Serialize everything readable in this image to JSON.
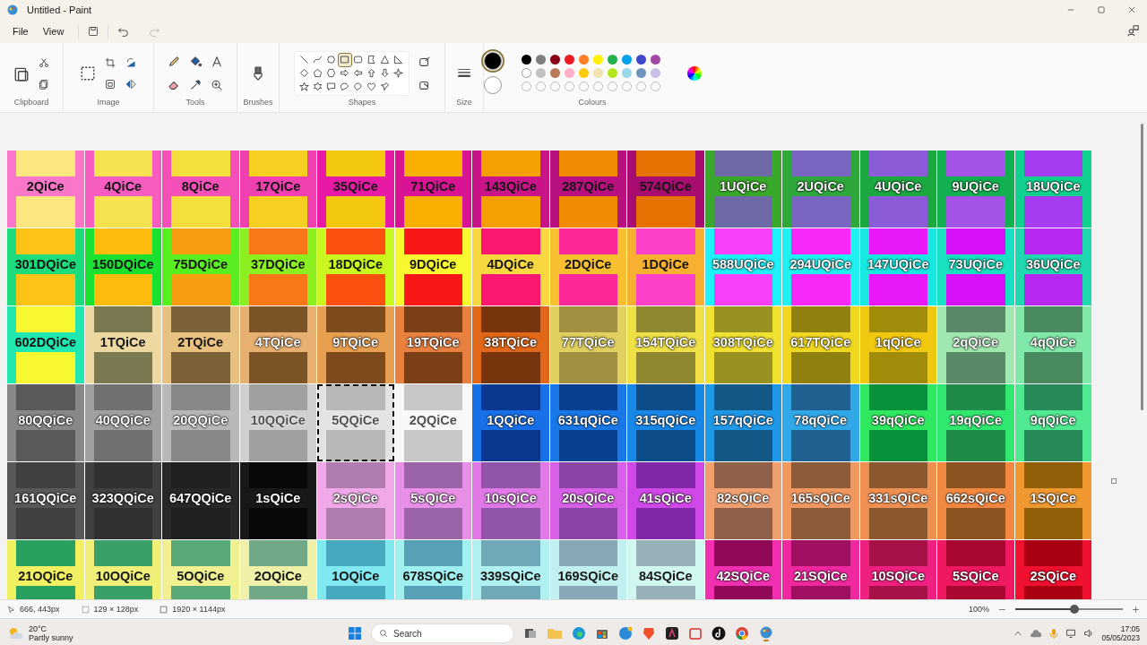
{
  "window": {
    "title": "Untitled - Paint"
  },
  "menu": [
    "File",
    "View"
  ],
  "ribbon_groups": [
    "Clipboard",
    "Image",
    "Tools",
    "Brushes",
    "Shapes",
    "Size",
    "Colours"
  ],
  "shapes": [
    {
      "kind": "line",
      "selected": false
    },
    {
      "kind": "curve",
      "selected": false
    },
    {
      "kind": "oval",
      "selected": false
    },
    {
      "kind": "rectangle",
      "selected": true
    },
    {
      "kind": "rounded",
      "selected": false
    },
    {
      "kind": "polygon",
      "selected": false
    },
    {
      "kind": "triangle",
      "selected": false
    },
    {
      "kind": "right-triangle",
      "selected": false
    },
    {
      "kind": "diamond",
      "selected": false
    },
    {
      "kind": "pentagon",
      "selected": false
    },
    {
      "kind": "hexagon",
      "selected": false
    },
    {
      "kind": "arrow-right",
      "selected": false
    },
    {
      "kind": "arrow-left",
      "selected": false
    },
    {
      "kind": "arrow-up",
      "selected": false
    },
    {
      "kind": "arrow-down",
      "selected": false
    },
    {
      "kind": "star-four",
      "selected": false
    },
    {
      "kind": "star-five",
      "selected": false
    },
    {
      "kind": "star-six",
      "selected": false
    },
    {
      "kind": "callout-rect",
      "selected": false
    },
    {
      "kind": "callout-oval",
      "selected": false
    },
    {
      "kind": "callout-round",
      "selected": false
    },
    {
      "kind": "heart",
      "selected": false
    },
    {
      "kind": "pin",
      "selected": false
    }
  ],
  "primary_colour": {
    "color": "#000000",
    "selected": true
  },
  "secondary_colour": {
    "color": "#ffffff",
    "selected": false
  },
  "palette": [
    {
      "kind": "swatch",
      "color": "#000000"
    },
    {
      "kind": "swatch",
      "color": "#7f7f7f"
    },
    {
      "kind": "swatch",
      "color": "#880015"
    },
    {
      "kind": "swatch",
      "color": "#ed1c24"
    },
    {
      "kind": "swatch",
      "color": "#ff7f27"
    },
    {
      "kind": "swatch",
      "color": "#fff200"
    },
    {
      "kind": "swatch",
      "color": "#22b14c"
    },
    {
      "kind": "swatch",
      "color": "#00a2e8"
    },
    {
      "kind": "swatch",
      "color": "#3f48cc"
    },
    {
      "kind": "swatch",
      "color": "#a349a4"
    },
    {
      "kind": "swatch",
      "color": "#ffffff"
    },
    {
      "kind": "swatch",
      "color": "#c3c3c3"
    },
    {
      "kind": "swatch",
      "color": "#b97a57"
    },
    {
      "kind": "swatch",
      "color": "#ffaec9"
    },
    {
      "kind": "swatch",
      "color": "#ffc90e"
    },
    {
      "kind": "swatch",
      "color": "#efe4b0"
    },
    {
      "kind": "swatch",
      "color": "#b5e61d"
    },
    {
      "kind": "swatch",
      "color": "#99d9ea"
    },
    {
      "kind": "swatch",
      "color": "#7092be"
    },
    {
      "kind": "swatch",
      "color": "#c8bfe7"
    },
    {
      "kind": "empty"
    },
    {
      "kind": "empty"
    },
    {
      "kind": "empty"
    },
    {
      "kind": "empty"
    },
    {
      "kind": "empty"
    },
    {
      "kind": "empty"
    },
    {
      "kind": "empty"
    },
    {
      "kind": "empty"
    },
    {
      "kind": "empty"
    },
    {
      "kind": "empty"
    }
  ],
  "canvas": {
    "rows": [
      {
        "tiles": [
          {
            "label": "2QiCe",
            "frame": {
              "color": "#f976c8"
            },
            "swatch": {
              "color": "#fbe67f"
            },
            "kind": "dark",
            "selected": false
          },
          {
            "label": "4QiCe",
            "frame": {
              "color": "#f75cc0"
            },
            "swatch": {
              "color": "#f7e34f"
            },
            "kind": "dark",
            "selected": false
          },
          {
            "label": "8QiCe",
            "frame": {
              "color": "#f550b8"
            },
            "swatch": {
              "color": "#f5df3f"
            },
            "kind": "dark",
            "selected": false
          },
          {
            "label": "17QiCe",
            "frame": {
              "color": "#f040b0"
            },
            "swatch": {
              "color": "#f5d020"
            },
            "kind": "dark",
            "selected": false
          },
          {
            "label": "35QiCe",
            "frame": {
              "color": "#e61aa5"
            },
            "swatch": {
              "color": "#f5c810"
            },
            "kind": "dark",
            "selected": false
          },
          {
            "label": "71QiCe",
            "frame": {
              "color": "#d81495"
            },
            "swatch": {
              "color": "#f8b000"
            },
            "kind": "dark",
            "selected": false
          },
          {
            "label": "143QiCe",
            "frame": {
              "color": "#c81488"
            },
            "swatch": {
              "color": "#f5a000"
            },
            "kind": "dark",
            "selected": false
          },
          {
            "label": "287QiCe",
            "frame": {
              "color": "#b8107e"
            },
            "swatch": {
              "color": "#f08a00"
            },
            "kind": "dark",
            "selected": false
          },
          {
            "label": "574QiCe",
            "frame": {
              "color": "#a80c70"
            },
            "swatch": {
              "color": "#e67000"
            },
            "kind": "dark",
            "selected": false
          },
          {
            "label": "1UQiCe",
            "frame": {
              "color": "#3aa82a"
            },
            "swatch": {
              "color": "#6e6aa8"
            },
            "kind": "light",
            "selected": false
          },
          {
            "label": "2UQiCe",
            "frame": {
              "color": "#2ea83a"
            },
            "swatch": {
              "color": "#7a66c0"
            },
            "kind": "light",
            "selected": false
          },
          {
            "label": "4UQiCe",
            "frame": {
              "color": "#1ca840"
            },
            "swatch": {
              "color": "#8c5cd8"
            },
            "kind": "light",
            "selected": false
          },
          {
            "label": "9UQiCe",
            "frame": {
              "color": "#12b050"
            },
            "swatch": {
              "color": "#a455e8"
            },
            "kind": "light",
            "selected": false
          },
          {
            "label": "18UQiCe",
            "frame": {
              "color": "#10d090"
            },
            "swatch": {
              "color": "#a83cf0"
            },
            "kind": "light",
            "selected": false
          }
        ]
      },
      {
        "tiles": [
          {
            "label": "301DQiCe",
            "frame": {
              "color": "#1cdc7c"
            },
            "swatch": {
              "color": "#fcc417"
            },
            "kind": "dark",
            "selected": false
          },
          {
            "label": "150DQiCe",
            "frame": {
              "color": "#1ae030"
            },
            "swatch": {
              "color": "#fcbc10"
            },
            "kind": "dark",
            "selected": false
          },
          {
            "label": "75DQiCe",
            "frame": {
              "color": "#58ee20"
            },
            "swatch": {
              "color": "#f89c10"
            },
            "kind": "dark",
            "selected": false
          },
          {
            "label": "37DQiCe",
            "frame": {
              "color": "#8cf020"
            },
            "swatch": {
              "color": "#f87818"
            },
            "kind": "dark",
            "selected": false
          },
          {
            "label": "18DQiCe",
            "frame": {
              "color": "#c8f820"
            },
            "swatch": {
              "color": "#fc5010"
            },
            "kind": "dark",
            "selected": false
          },
          {
            "label": "9DQiCe",
            "frame": {
              "color": "#f8f830"
            },
            "swatch": {
              "color": "#f81818"
            },
            "kind": "dark",
            "selected": false
          },
          {
            "label": "4DQiCe",
            "frame": {
              "color": "#f8d840"
            },
            "swatch": {
              "color": "#fc1870"
            },
            "kind": "dark",
            "selected": false
          },
          {
            "label": "2DQiCe",
            "frame": {
              "color": "#f8c030"
            },
            "swatch": {
              "color": "#fc2898"
            },
            "kind": "dark",
            "selected": false
          },
          {
            "label": "1DQiCe",
            "frame": {
              "color": "#f8b030"
            },
            "swatch": {
              "color": "#fc40c8"
            },
            "kind": "dark",
            "selected": false
          },
          {
            "label": "588UQiCe",
            "frame": {
              "color": "#20f0f8"
            },
            "swatch": {
              "color": "#f840f8"
            },
            "kind": "light",
            "selected": false
          },
          {
            "label": "294UQiCe",
            "frame": {
              "color": "#20f0f0"
            },
            "swatch": {
              "color": "#f828f8"
            },
            "kind": "light",
            "selected": false
          },
          {
            "label": "147UQiCe",
            "frame": {
              "color": "#18e8e0"
            },
            "swatch": {
              "color": "#e818f8"
            },
            "kind": "light",
            "selected": false
          },
          {
            "label": "73UQiCe",
            "frame": {
              "color": "#18e0c0"
            },
            "swatch": {
              "color": "#d810f8"
            },
            "kind": "light",
            "selected": false
          },
          {
            "label": "36UQiCe",
            "frame": {
              "color": "#20d8b0"
            },
            "swatch": {
              "color": "#b828f0"
            },
            "kind": "light",
            "selected": false
          }
        ]
      },
      {
        "tiles": [
          {
            "label": "602DQiCe",
            "frame": {
              "color": "#20e8b0"
            },
            "swatch": {
              "color": "#f8f830"
            },
            "kind": "dark",
            "selected": false
          },
          {
            "label": "1TQiCe",
            "frame": {
              "color": "#ecd8a0"
            },
            "swatch": {
              "color": "#7a7850"
            },
            "kind": "dark",
            "selected": false
          },
          {
            "label": "2TQiCe",
            "frame": {
              "color": "#e8c080"
            },
            "swatch": {
              "color": "#7c6038"
            },
            "kind": "dark",
            "selected": false
          },
          {
            "label": "4TQiCe",
            "frame": {
              "color": "#e8b070"
            },
            "swatch": {
              "color": "#7c5428"
            },
            "kind": "light",
            "selected": false
          },
          {
            "label": "9TQiCe",
            "frame": {
              "color": "#e8a050"
            },
            "swatch": {
              "color": "#7c4a1c"
            },
            "kind": "light",
            "selected": false
          },
          {
            "label": "19TQiCe",
            "frame": {
              "color": "#e88040"
            },
            "swatch": {
              "color": "#7c4018"
            },
            "kind": "light",
            "selected": false
          },
          {
            "label": "38TQiCe",
            "frame": {
              "color": "#e06818"
            },
            "swatch": {
              "color": "#78340c"
            },
            "kind": "light",
            "selected": false
          },
          {
            "label": "77TQiCe",
            "frame": {
              "color": "#e0d060"
            },
            "swatch": {
              "color": "#a09040"
            },
            "kind": "light",
            "selected": false
          },
          {
            "label": "154TQiCe",
            "frame": {
              "color": "#f0e048"
            },
            "swatch": {
              "color": "#908830"
            },
            "kind": "light",
            "selected": false
          },
          {
            "label": "308TQiCe",
            "frame": {
              "color": "#f0e030"
            },
            "swatch": {
              "color": "#989020"
            },
            "kind": "light",
            "selected": false
          },
          {
            "label": "617TQiCe",
            "frame": {
              "color": "#f0d820"
            },
            "swatch": {
              "color": "#908010"
            },
            "kind": "light",
            "selected": false
          },
          {
            "label": "1qQiCe",
            "frame": {
              "color": "#f0c810"
            },
            "swatch": {
              "color": "#a08c08"
            },
            "kind": "light",
            "selected": false
          },
          {
            "label": "2qQiCe",
            "frame": {
              "color": "#a0e8b0"
            },
            "swatch": {
              "color": "#588a68"
            },
            "kind": "light",
            "selected": false
          },
          {
            "label": "4qQiCe",
            "frame": {
              "color": "#80e8a8"
            },
            "swatch": {
              "color": "#4a8a60"
            },
            "kind": "light",
            "selected": false
          }
        ]
      },
      {
        "tiles": [
          {
            "label": "80QQiCe",
            "frame": {
              "color": "#888888"
            },
            "swatch": {
              "color": "#5a5a5a"
            },
            "kind": "light",
            "selected": false
          },
          {
            "label": "40QQiCe",
            "frame": {
              "color": "#a0a0a0"
            },
            "swatch": {
              "color": "#707070"
            },
            "kind": "light",
            "selected": false
          },
          {
            "label": "20QQiCe",
            "frame": {
              "color": "#b8b8b8"
            },
            "swatch": {
              "color": "#888888"
            },
            "kind": "light",
            "selected": false
          },
          {
            "label": "10QQiCe",
            "frame": {
              "color": "#d0d0d0"
            },
            "swatch": {
              "color": "#a0a0a0"
            },
            "kind": "pale",
            "selected": false
          },
          {
            "label": "5QQiCe",
            "frame": {
              "color": "#e4e4e4"
            },
            "swatch": {
              "color": "#b8b8b8"
            },
            "kind": "pale",
            "selected": true
          },
          {
            "label": "2QQiCe",
            "frame": {
              "color": "#f8f8f8"
            },
            "swatch": {
              "color": "#c8c8c8"
            },
            "kind": "pale",
            "selected": false
          },
          {
            "label": "1QQiCe",
            "frame": {
              "color": "#1870e8"
            },
            "swatch": {
              "color": "#0a3890"
            },
            "kind": "light",
            "selected": false
          },
          {
            "label": "631qQiCe",
            "frame": {
              "color": "#1878e8"
            },
            "swatch": {
              "color": "#0a4090"
            },
            "kind": "light",
            "selected": false
          },
          {
            "label": "315qQiCe",
            "frame": {
              "color": "#1888e8"
            },
            "swatch": {
              "color": "#0c4c88"
            },
            "kind": "light",
            "selected": false
          },
          {
            "label": "157qQiCe",
            "frame": {
              "color": "#2098e8"
            },
            "swatch": {
              "color": "#145888"
            },
            "kind": "light",
            "selected": false
          },
          {
            "label": "78qQiCe",
            "frame": {
              "color": "#30a8e8"
            },
            "swatch": {
              "color": "#206090"
            },
            "kind": "light",
            "selected": false
          },
          {
            "label": "39qQiCe",
            "frame": {
              "color": "#30e860"
            },
            "swatch": {
              "color": "#08903a"
            },
            "kind": "light",
            "selected": false
          },
          {
            "label": "19qQiCe",
            "frame": {
              "color": "#30e870"
            },
            "swatch": {
              "color": "#208a48"
            },
            "kind": "light",
            "selected": false
          },
          {
            "label": "9qQiCe",
            "frame": {
              "color": "#50e890"
            },
            "swatch": {
              "color": "#288a58"
            },
            "kind": "light",
            "selected": false
          }
        ]
      },
      {
        "tiles": [
          {
            "label": "161QQiCe",
            "frame": {
              "color": "#585858"
            },
            "swatch": {
              "color": "#404040"
            },
            "kind": "light",
            "selected": false
          },
          {
            "label": "323QQiCe",
            "frame": {
              "color": "#404040"
            },
            "swatch": {
              "color": "#303030"
            },
            "kind": "light",
            "selected": false
          },
          {
            "label": "647QQiCe",
            "frame": {
              "color": "#282828"
            },
            "swatch": {
              "color": "#202020"
            },
            "kind": "light",
            "selected": false
          },
          {
            "label": "1sQiCe",
            "frame": {
              "color": "#181818"
            },
            "swatch": {
              "color": "#080808"
            },
            "kind": "light",
            "selected": false
          },
          {
            "label": "2sQiCe",
            "frame": {
              "color": "#f0a8e8"
            },
            "swatch": {
              "color": "#b07cb0"
            },
            "kind": "light",
            "selected": false
          },
          {
            "label": "5sQiCe",
            "frame": {
              "color": "#e890e8"
            },
            "swatch": {
              "color": "#9c64a8"
            },
            "kind": "light",
            "selected": false
          },
          {
            "label": "10sQiCe",
            "frame": {
              "color": "#e078e8"
            },
            "swatch": {
              "color": "#9054a8"
            },
            "kind": "light",
            "selected": false
          },
          {
            "label": "20sQiCe",
            "frame": {
              "color": "#d860e8"
            },
            "swatch": {
              "color": "#8c44a8"
            },
            "kind": "light",
            "selected": false
          },
          {
            "label": "41sQiCe",
            "frame": {
              "color": "#d048e8"
            },
            "swatch": {
              "color": "#8028a8"
            },
            "kind": "light",
            "selected": false
          },
          {
            "label": "82sQiCe",
            "frame": {
              "color": "#f0a070"
            },
            "swatch": {
              "color": "#906048"
            },
            "kind": "light",
            "selected": false
          },
          {
            "label": "165sQiCe",
            "frame": {
              "color": "#f09860"
            },
            "swatch": {
              "color": "#8c5c38"
            },
            "kind": "light",
            "selected": false
          },
          {
            "label": "331sQiCe",
            "frame": {
              "color": "#f09050"
            },
            "swatch": {
              "color": "#8c5830"
            },
            "kind": "light",
            "selected": false
          },
          {
            "label": "662sQiCe",
            "frame": {
              "color": "#f08840"
            },
            "swatch": {
              "color": "#8c5420"
            },
            "kind": "light",
            "selected": false
          },
          {
            "label": "1SQiCe",
            "frame": {
              "color": "#f09830"
            },
            "swatch": {
              "color": "#906008"
            },
            "kind": "light",
            "selected": false
          }
        ]
      },
      {
        "tiles": [
          {
            "label": "21OQiCe",
            "frame": {
              "color": "#f0f060"
            },
            "swatch": {
              "color": "#28a060"
            },
            "kind": "dark",
            "selected": false
          },
          {
            "label": "10OQiCe",
            "frame": {
              "color": "#f0f078"
            },
            "swatch": {
              "color": "#38a068"
            },
            "kind": "dark",
            "selected": false
          },
          {
            "label": "5OQiCe",
            "frame": {
              "color": "#f0f090"
            },
            "swatch": {
              "color": "#58a878"
            },
            "kind": "dark",
            "selected": false
          },
          {
            "label": "2OQiCe",
            "frame": {
              "color": "#f0f0a8"
            },
            "swatch": {
              "color": "#70a888"
            },
            "kind": "dark",
            "selected": false
          },
          {
            "label": "1OQiCe",
            "frame": {
              "color": "#80e8f0"
            },
            "swatch": {
              "color": "#48a8c0"
            },
            "kind": "dark",
            "selected": false
          },
          {
            "label": "678SQiCe",
            "frame": {
              "color": "#a0f0f0"
            },
            "swatch": {
              "color": "#58a0b8"
            },
            "kind": "dark",
            "selected": false
          },
          {
            "label": "339SQiCe",
            "frame": {
              "color": "#b0f0f0"
            },
            "swatch": {
              "color": "#70a8b8"
            },
            "kind": "dark",
            "selected": false
          },
          {
            "label": "169SQiCe",
            "frame": {
              "color": "#c0f0f0"
            },
            "swatch": {
              "color": "#88a8b8"
            },
            "kind": "dark",
            "selected": false
          },
          {
            "label": "84SQiCe",
            "frame": {
              "color": "#d0f8f0"
            },
            "swatch": {
              "color": "#98b0b8"
            },
            "kind": "dark",
            "selected": false
          },
          {
            "label": "42SQiCe",
            "frame": {
              "color": "#f030b0"
            },
            "swatch": {
              "color": "#900858"
            },
            "kind": "light",
            "selected": false
          },
          {
            "label": "21SQiCe",
            "frame": {
              "color": "#f028a0"
            },
            "swatch": {
              "color": "#a01060"
            },
            "kind": "light",
            "selected": false
          },
          {
            "label": "10SQiCe",
            "frame": {
              "color": "#f02080"
            },
            "swatch": {
              "color": "#a81048"
            },
            "kind": "light",
            "selected": false
          },
          {
            "label": "5SQiCe",
            "frame": {
              "color": "#f01860"
            },
            "swatch": {
              "color": "#a80830"
            },
            "kind": "light",
            "selected": false
          },
          {
            "label": "2SQiCe",
            "frame": {
              "color": "#f01030"
            },
            "swatch": {
              "color": "#a80010"
            },
            "kind": "light",
            "selected": false
          }
        ]
      }
    ]
  },
  "status_bar": {
    "cursor": "666, 443px",
    "selection": "129 × 128px",
    "image_size": "1920 × 1144px",
    "zoom": "100%",
    "zoom_slider": {
      "level": 0.55
    }
  },
  "taskbar": {
    "temperature": "20°C",
    "weather": "Partly sunny",
    "search": "Search",
    "time": "17:05",
    "date": "05/05/2023"
  }
}
